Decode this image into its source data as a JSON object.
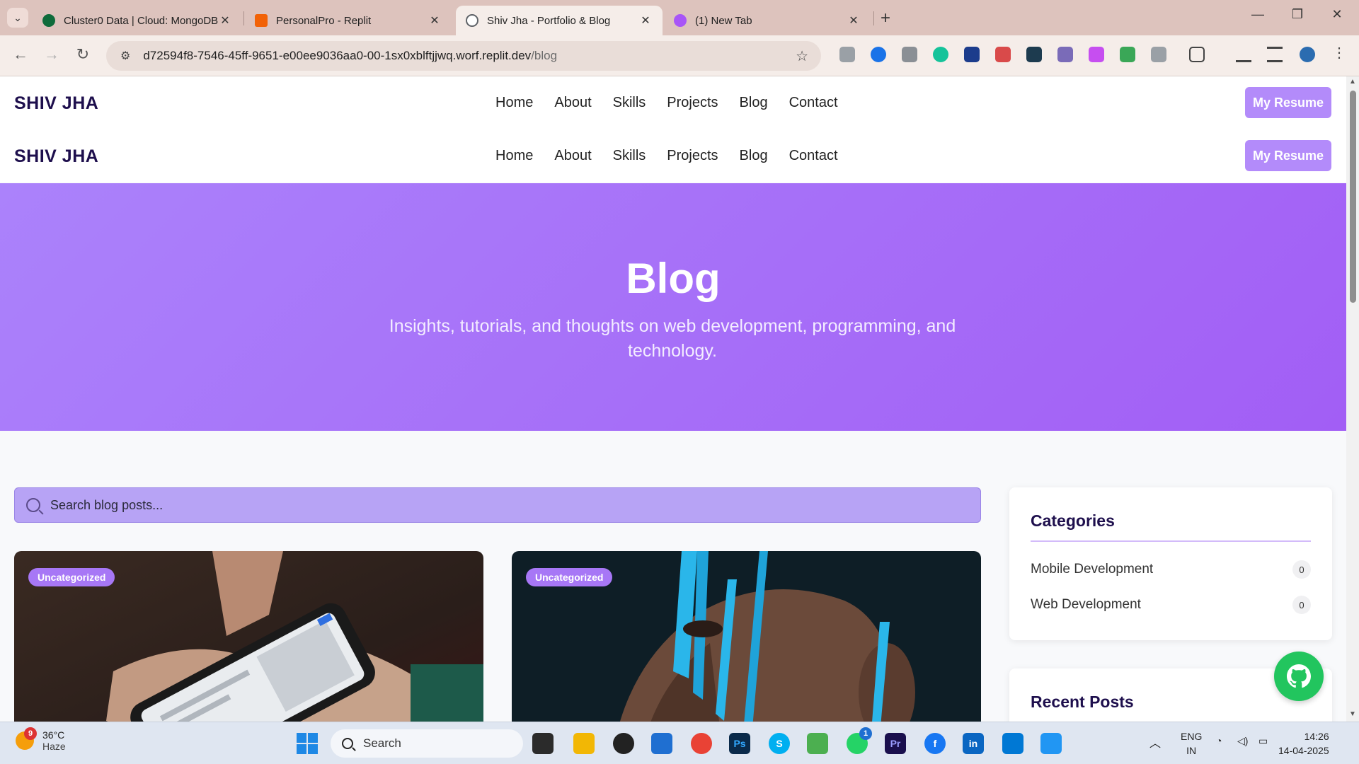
{
  "browser": {
    "tabs": [
      {
        "title": "Cluster0 Data | Cloud: MongoDB",
        "favicon_color": "#0f6b3b"
      },
      {
        "title": "PersonalPro - Replit",
        "favicon_color": "#f26207"
      },
      {
        "title": "Shiv Jha - Portfolio & Blog",
        "favicon_color": "#5f6368"
      },
      {
        "title": "(1) New Tab",
        "favicon_color": "#a855f7"
      }
    ],
    "url_host": "d72594f8-7546-45ff-9651-e00ee9036aa0-00-1sx0xblftjjwq.worf.replit.dev",
    "url_path": "/blog"
  },
  "site": {
    "brand": "SHIV JHA",
    "nav": [
      "Home",
      "About",
      "Skills",
      "Projects",
      "Blog",
      "Contact"
    ],
    "resume_label": "My Resume"
  },
  "hero": {
    "title": "Blog",
    "subtitle": "Insights, tutorials, and thoughts on web development, programming, and technology."
  },
  "search": {
    "placeholder": "Search blog posts..."
  },
  "posts": [
    {
      "category": "Uncategorized"
    },
    {
      "category": "Uncategorized"
    }
  ],
  "sidebar": {
    "categories_title": "Categories",
    "categories": [
      {
        "name": "Mobile Development",
        "count": "0"
      },
      {
        "name": "Web Development",
        "count": "0"
      }
    ],
    "recent_title": "Recent Posts"
  },
  "taskbar": {
    "weather_temp": "36°C",
    "weather_desc": "Haze",
    "weather_badge": "9",
    "search_label": "Search",
    "whatsapp_badge": "1",
    "lang_line1": "ENG",
    "lang_line2": "IN",
    "time": "14:26",
    "date": "14-04-2025"
  },
  "colors": {
    "accent": "#a777f6",
    "brand": "#1e0f4d",
    "github_fab": "#22c55e"
  }
}
